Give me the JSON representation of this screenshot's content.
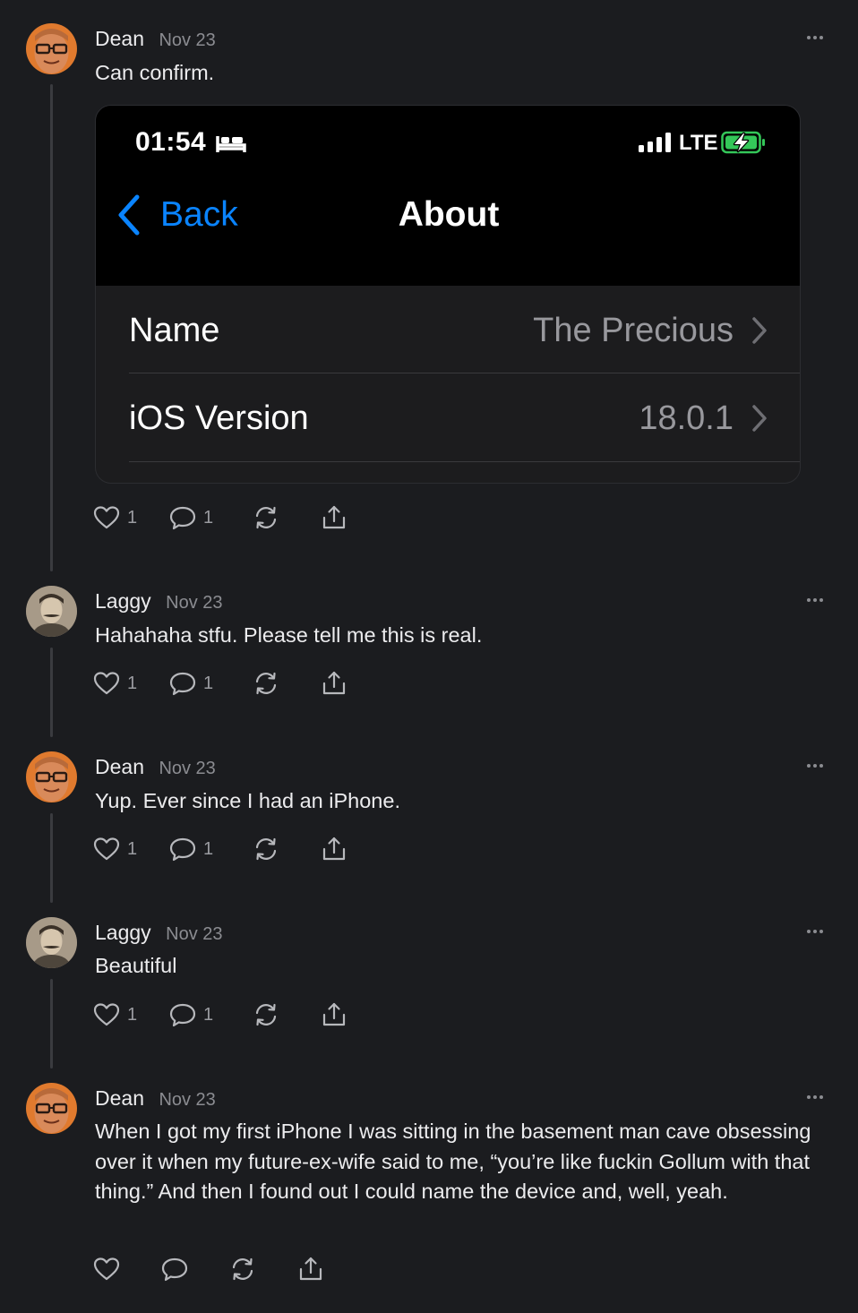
{
  "colors": {
    "background": "#1b1c1f",
    "accent_blue": "#0a84ff",
    "battery_green": "#34c759"
  },
  "posts": [
    {
      "author": "Dean",
      "date": "Nov 23",
      "text": "Can confirm.",
      "likes": "1",
      "comments": "1",
      "embed": {
        "status_time": "01:54",
        "network": "LTE",
        "nav_back": "Back",
        "nav_title": "About",
        "rows": [
          {
            "label": "Name",
            "value": "The Precious"
          },
          {
            "label": "iOS Version",
            "value": "18.0.1"
          }
        ]
      }
    },
    {
      "author": "Laggy",
      "date": "Nov 23",
      "text": "Hahahaha stfu. Please tell me this is real.",
      "likes": "1",
      "comments": "1"
    },
    {
      "author": "Dean",
      "date": "Nov 23",
      "text": "Yup. Ever since I had an iPhone.",
      "likes": "1",
      "comments": "1"
    },
    {
      "author": "Laggy",
      "date": "Nov 23",
      "text": "Beautiful",
      "likes": "1",
      "comments": "1"
    },
    {
      "author": "Dean",
      "date": "Nov 23",
      "text": "When I got my first iPhone I was sitting in the basement man cave obsessing over it when my future-ex-wife said to me, “you’re like fuckin Gollum with that thing.” And then I found out I could name the device and, well, yeah.",
      "likes": "",
      "comments": ""
    }
  ]
}
